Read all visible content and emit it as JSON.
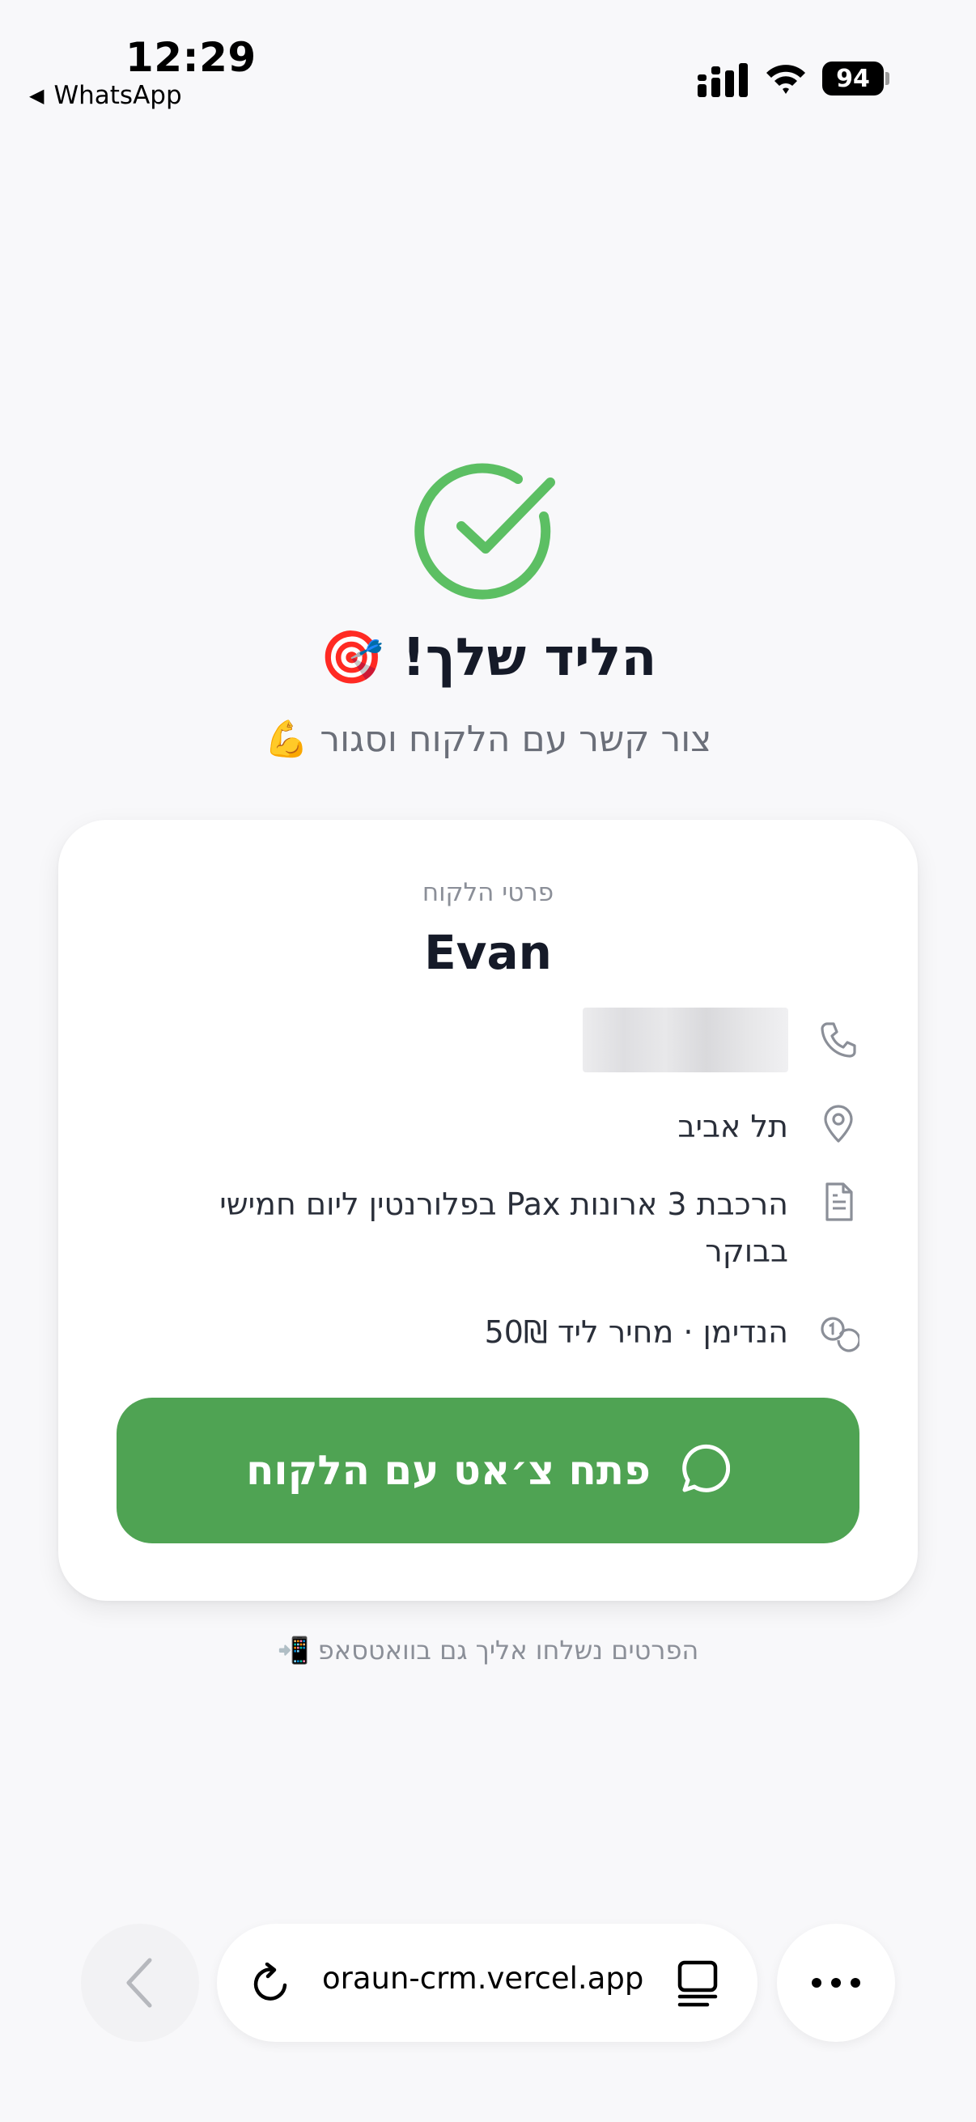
{
  "status_bar": {
    "time": "12:29",
    "back_app": "WhatsApp",
    "battery": "94"
  },
  "hero": {
    "title": "הליד שלך! 🎯",
    "subtitle": "צור קשר עם הלקוח וסגור 💪",
    "success_color": "#5cbf63"
  },
  "card": {
    "label": "פרטי הלקוח",
    "name": "Evan",
    "phone": "",
    "city": "תל אביב",
    "description": "הרכבת 3 ארונות Pax בפלורנטין ליום חמישי בבוקר",
    "pricing": "הנדימן · מחיר ליד 50₪",
    "cta_label": "פתח צ׳אט עם הלקוח",
    "cta_color": "#4fa353"
  },
  "footnote": "הפרטים נשלחו אליך גם בוואטסאפ 📲",
  "browser": {
    "url": "oraun-crm.vercel.app"
  },
  "icons": [
    "back-arrow-icon",
    "signal-icon",
    "wifi-icon",
    "check-circle-icon",
    "phone-icon",
    "location-pin-icon",
    "document-icon",
    "coins-icon",
    "chat-bubble-icon",
    "chevron-left-icon",
    "reload-icon",
    "tabs-icon",
    "more-icon"
  ]
}
